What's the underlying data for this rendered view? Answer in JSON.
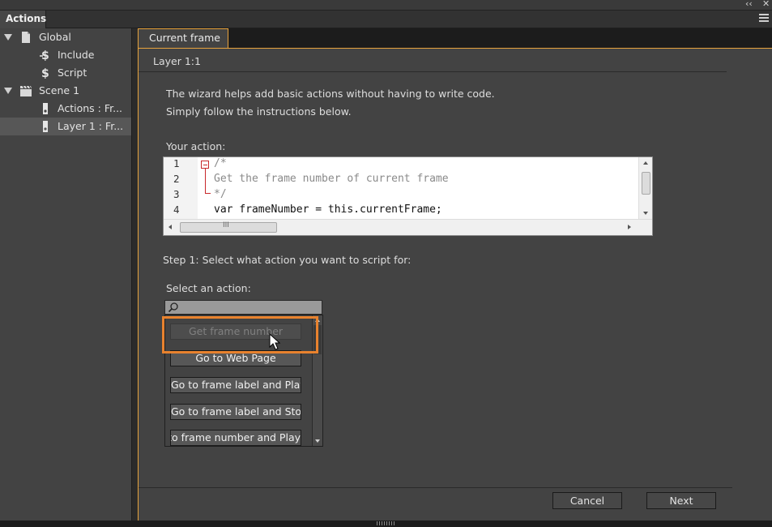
{
  "panel": {
    "collapse_glyph": "‹‹",
    "close_glyph": "✕",
    "tab_title": "Actions"
  },
  "tree": {
    "items": [
      {
        "label": "Global",
        "icon": "document-icon"
      },
      {
        "label": "Include",
        "icon": "include-script-icon"
      },
      {
        "label": "Script",
        "icon": "script-icon"
      },
      {
        "label": "Scene 1",
        "icon": "scene-clapper-icon"
      },
      {
        "label": "Actions : Fr...",
        "icon": "frame-icon"
      },
      {
        "label": "Layer 1 : Fr...",
        "icon": "frame-icon"
      }
    ],
    "selected_index": 5
  },
  "main": {
    "tab_label": "Current frame",
    "layer_label": "Layer 1:1",
    "intro_line1": "The wizard helps add basic actions without having to write code.",
    "intro_line2": "Simply follow the instructions below.",
    "your_action_label": "Your action:",
    "code": {
      "line_numbers": [
        "1",
        "2",
        "3",
        "4"
      ],
      "lines": [
        "/*",
        "Get the frame number of current frame",
        "*/",
        "var frameNumber = this.currentFrame;"
      ],
      "hscroll_grip": "III"
    },
    "step1_label": "Step 1: Select what action you want to script for:",
    "select_action_label": "Select an action:",
    "search_placeholder": "",
    "actions": [
      {
        "label": "Get frame number",
        "disabled": true
      },
      {
        "label": "Go to Web Page",
        "disabled": false
      },
      {
        "label": "Go to frame label and Play",
        "disabled": false
      },
      {
        "label": "Go to frame label and Stop",
        "disabled": false
      },
      {
        "label": "Go to frame number and Play",
        "disabled": false
      }
    ],
    "cancel_label": "Cancel",
    "next_label": "Next"
  },
  "colors": {
    "accent": "#e8a33d",
    "highlight": "#e8822e",
    "fold_marker": "#c8282a"
  }
}
